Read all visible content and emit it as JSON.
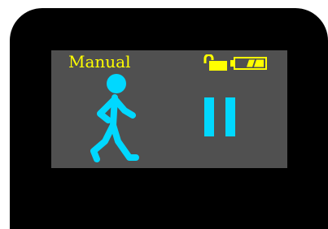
{
  "screen": {
    "mode_label": "Manual",
    "lock_state": "unlocked",
    "battery_level": 0.67,
    "activity_icon": "walking-person-icon",
    "playback_state_icon": "pause-icon"
  },
  "colors": {
    "device_body": "#000000",
    "screen_background": "#505050",
    "status_yellow": "#ffff00",
    "accent_cyan": "#00d8ff"
  }
}
